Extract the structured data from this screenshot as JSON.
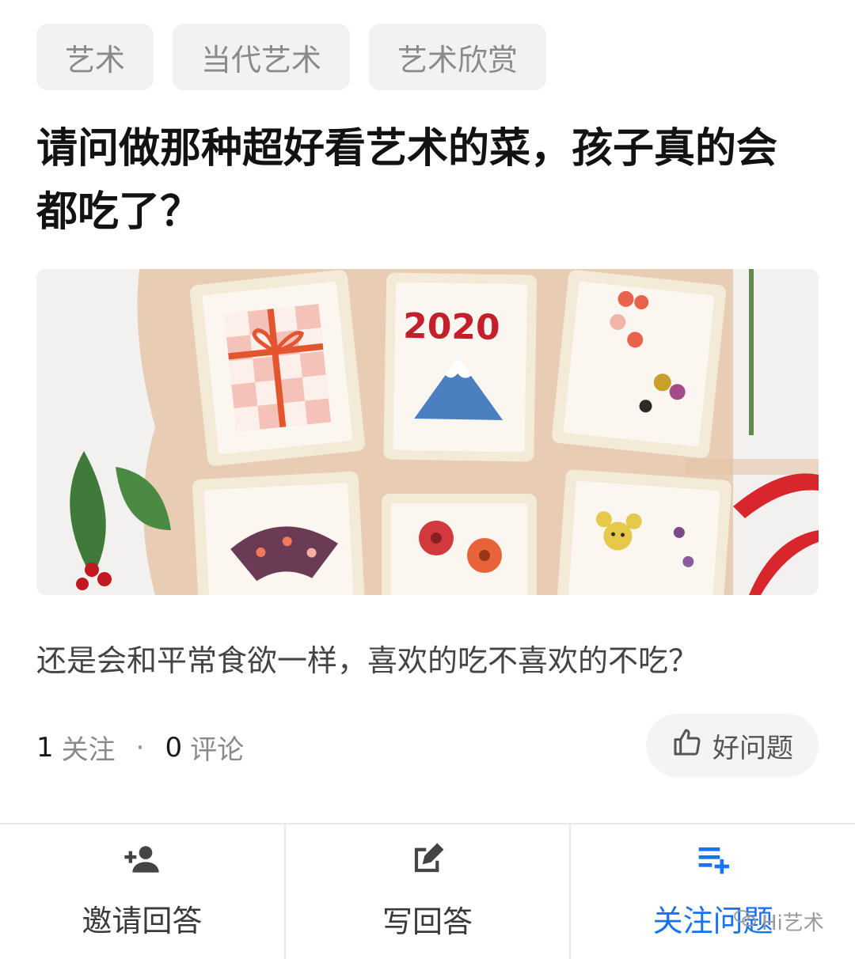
{
  "tags": [
    "艺术",
    "当代艺术",
    "艺术欣赏"
  ],
  "question": {
    "title": "请问做那种超好看艺术的菜，孩子真的会都吃了？",
    "description": "还是会和平常食欲一样，喜欢的吃不喜欢的不吃？",
    "image": {
      "toast_year": "2020"
    }
  },
  "meta": {
    "follow_count": "1",
    "follow_label": "关注",
    "separator": "·",
    "comment_count": "0",
    "comment_label": "评论"
  },
  "good_question": {
    "label": "好问题",
    "icon": "thumbs-up-icon"
  },
  "bottom_bar": {
    "invite": {
      "label": "邀请回答",
      "icon": "add-user-icon"
    },
    "write": {
      "label": "写回答",
      "icon": "edit-icon"
    },
    "follow": {
      "label": "关注问题",
      "icon": "playlist-add-icon"
    }
  },
  "colors": {
    "accent": "#1772f6",
    "tag_bg": "#f2f2f2"
  },
  "watermark": "Hi艺术"
}
